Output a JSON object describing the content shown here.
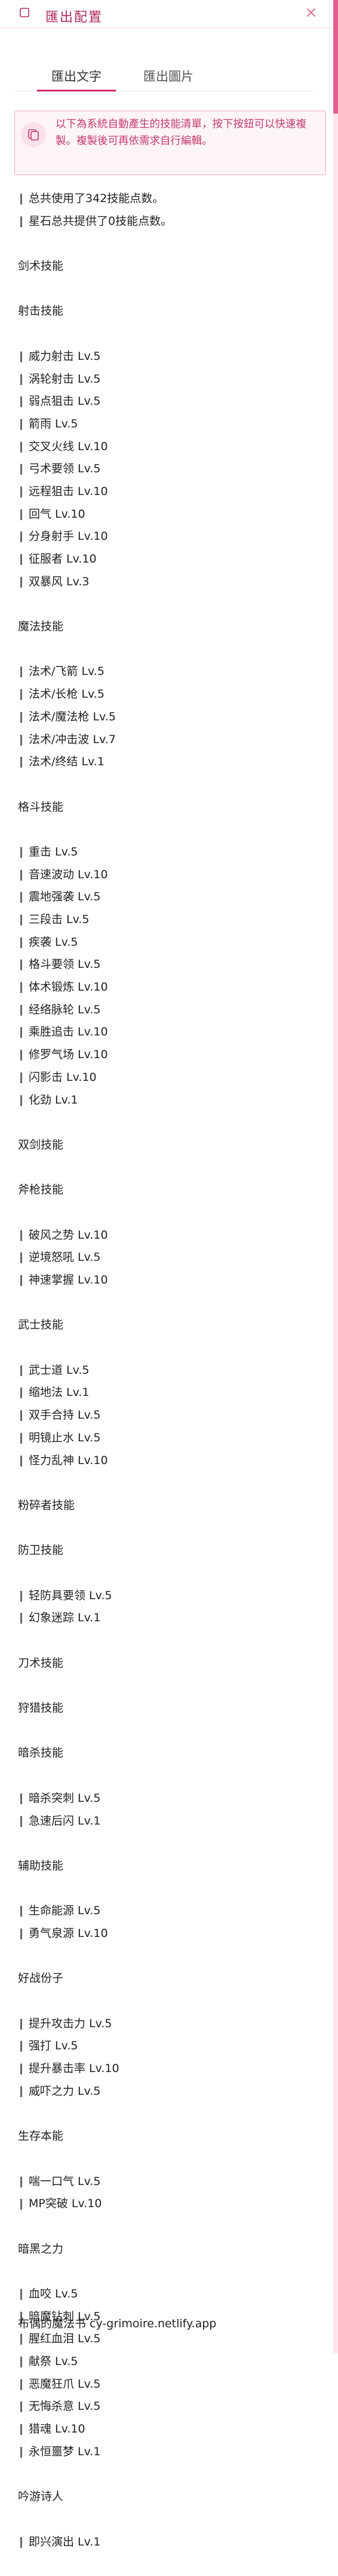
{
  "header": {
    "title": "匯出配置",
    "close_icon": "close-icon"
  },
  "tabs": [
    {
      "label": "匯出文字"
    },
    {
      "label": "匯出圖片"
    }
  ],
  "notice": {
    "icon": "copy-icon",
    "text": "以下為系統自動產生的技能清單，按下按鈕可以快速複製。複製後可再依需求自行編輯。"
  },
  "summary": [
    "总共使用了342技能点数。",
    "星石总共提供了0技能点数。"
  ],
  "sections": [
    {
      "title": "剑术技能",
      "items": []
    },
    {
      "title": "射击技能",
      "items": [
        "威力射击 Lv.5",
        "涡轮射击 Lv.5",
        "弱点狙击 Lv.5",
        "箭雨 Lv.5",
        "交叉火线 Lv.10",
        "弓术要领 Lv.5",
        "远程狙击 Lv.10",
        "回气 Lv.10",
        "分身射手 Lv.10",
        "征服者 Lv.10",
        "双暴风 Lv.3"
      ]
    },
    {
      "title": "魔法技能",
      "items": [
        "法术/飞箭 Lv.5",
        "法术/长枪 Lv.5",
        "法术/魔法枪 Lv.5",
        "法术/冲击波 Lv.7",
        "法术/终结 Lv.1"
      ]
    },
    {
      "title": "格斗技能",
      "items": [
        "重击 Lv.5",
        "音速波动 Lv.10",
        "震地强袭 Lv.5",
        "三段击 Lv.5",
        "疾袭 Lv.5",
        "格斗要领 Lv.5",
        "体术锻炼 Lv.10",
        "经络脉轮 Lv.5",
        "乘胜追击 Lv.10",
        "修罗气场 Lv.10",
        "闪影击 Lv.10",
        "化劲 Lv.1"
      ]
    },
    {
      "title": "双剑技能",
      "items": []
    },
    {
      "title": "斧枪技能",
      "items": [
        "破风之势 Lv.10",
        "逆境怒吼 Lv.5",
        "神速掌握 Lv.10"
      ]
    },
    {
      "title": "武士技能",
      "items": [
        "武士道 Lv.5",
        "缩地法 Lv.1",
        "双手合持 Lv.5",
        "明镜止水 Lv.5",
        "怪力乱神 Lv.10"
      ]
    },
    {
      "title": "粉碎者技能",
      "items": []
    },
    {
      "title": "防卫技能",
      "items": [
        "轻防具要领 Lv.5",
        "幻象迷踪 Lv.1"
      ]
    },
    {
      "title": "刀术技能",
      "items": []
    },
    {
      "title": "狩猎技能",
      "items": []
    },
    {
      "title": "暗杀技能",
      "items": [
        "暗杀突刺 Lv.5",
        "急速后闪 Lv.1"
      ]
    },
    {
      "title": "辅助技能",
      "items": [
        "生命能源 Lv.5",
        "勇气泉源 Lv.10"
      ]
    },
    {
      "title": "好战份子",
      "items": [
        "提升攻击力 Lv.5",
        "强打 Lv.5",
        "提升暴击率 Lv.10",
        "威吓之力 Lv.5"
      ]
    },
    {
      "title": "生存本能",
      "items": [
        "喘一口气 Lv.5",
        "MP突破 Lv.10"
      ]
    },
    {
      "title": "暗黑之力",
      "items": [
        "血咬 Lv.5",
        "暗魔钻刺 Lv.5",
        "腥红血泪 Lv.5",
        "献祭 Lv.5",
        "恶魔狂爪 Lv.5",
        "无悔杀意 Lv.5",
        "猎魂 Lv.10",
        "永恒噩梦 Lv.1"
      ]
    },
    {
      "title": "吟游诗人",
      "items": [
        "即兴演出 Lv.1"
      ]
    }
  ],
  "footer": {
    "text": "布偶的魔法书 cy-grimoire.netlify.app"
  }
}
